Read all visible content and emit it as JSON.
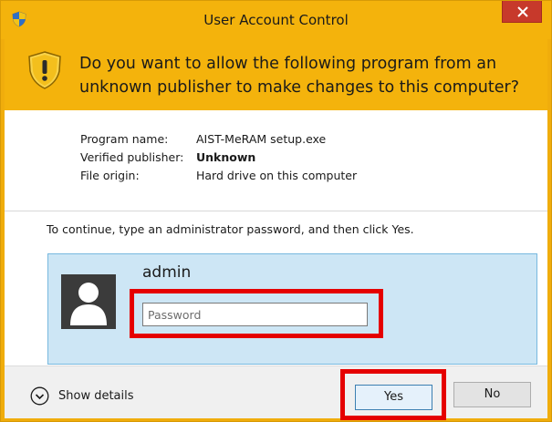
{
  "window": {
    "title": "User Account Control",
    "shield_icon": "uac-shield-icon",
    "close_icon": "close-icon"
  },
  "header": {
    "question": "Do you want to allow the following program from an unknown publisher to make changes to this computer?"
  },
  "program_info": [
    {
      "key": "Program name:",
      "value": "AIST-MeRAM setup.exe",
      "bold": false
    },
    {
      "key": "Verified publisher:",
      "value": "Unknown",
      "bold": true
    },
    {
      "key": "File origin:",
      "value": "Hard drive on this computer",
      "bold": false
    }
  ],
  "instruction": "To continue, type an administrator password, and then click Yes.",
  "credential": {
    "username": "admin",
    "password_placeholder": "Password",
    "password_value": ""
  },
  "footer": {
    "details_label": "Show details",
    "yes_label": "Yes",
    "no_label": "No"
  },
  "colors": {
    "title_bar": "#f4b30c",
    "close_button": "#c7392b",
    "credential_tile": "#cde6f5",
    "highlight_box": "#e50000"
  }
}
